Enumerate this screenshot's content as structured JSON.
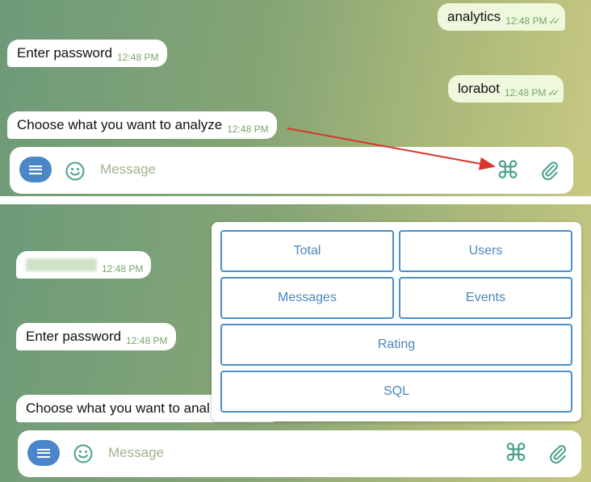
{
  "top": {
    "messages": [
      {
        "text": "analytics",
        "time": "12:48 PM",
        "outgoing": true
      },
      {
        "text": "Enter password",
        "time": "12:48 PM",
        "outgoing": false
      },
      {
        "text": "lorabot",
        "time": "12:48 PM",
        "outgoing": true
      },
      {
        "text": "Choose what you want to analyze",
        "time": "12:48 PM",
        "outgoing": false
      }
    ],
    "input_placeholder": "Message"
  },
  "bottom": {
    "messages": [
      {
        "text": "",
        "time": "12:48 PM",
        "outgoing": false,
        "redacted": true
      },
      {
        "text": "Enter password",
        "time": "12:48 PM",
        "outgoing": false
      },
      {
        "text": "Choose what you want to anal",
        "outgoing": false
      }
    ],
    "input_placeholder": "Message",
    "keyboard": {
      "buttons": [
        "Total",
        "Users",
        "Messages",
        "Events",
        "Rating",
        "SQL"
      ]
    }
  },
  "icons": {
    "menu": "menu-icon",
    "emoji": "emoji-icon",
    "command": "⌘",
    "attach": "paperclip-icon",
    "annotation_arrow": "red-arrow"
  },
  "colors": {
    "accent": "#4a86c8",
    "time_text": "#7aa56b",
    "outgoing_bubble": "#eef8dd",
    "command_icon": "#4aa08c",
    "keyboard_border": "#4b8fc9",
    "annotation": "#d9342b"
  }
}
